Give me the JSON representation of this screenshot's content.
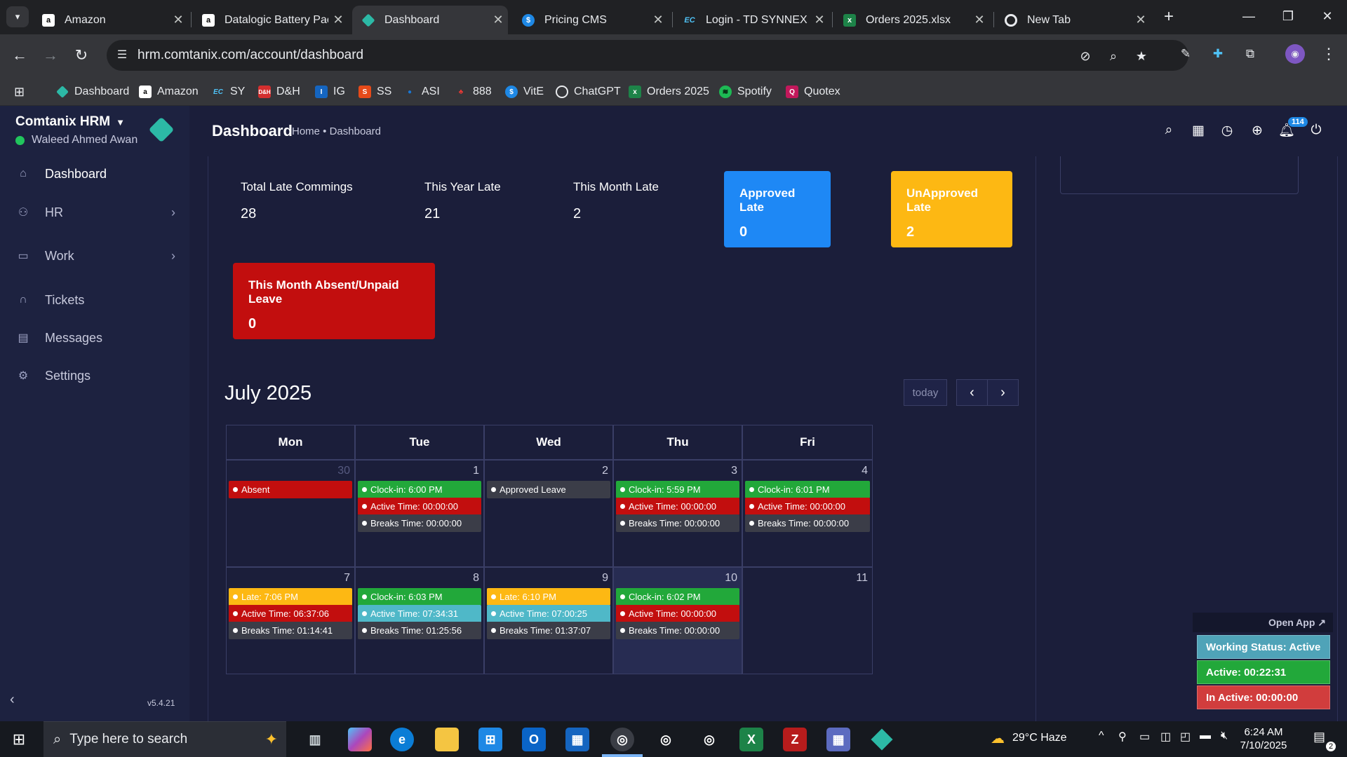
{
  "browser": {
    "tabs": [
      {
        "title": "Amazon",
        "icon": "amazon-icon",
        "active": false
      },
      {
        "title": "Datalogic Battery Pac",
        "icon": "amazon-icon",
        "active": false
      },
      {
        "title": "Dashboard",
        "icon": "comtanix-icon",
        "active": true
      },
      {
        "title": "Pricing CMS",
        "icon": "dollar-icon",
        "active": false
      },
      {
        "title": "Login - TD SYNNEX",
        "icon": "ec-icon",
        "active": false
      },
      {
        "title": "Orders 2025.xlsx",
        "icon": "excel-icon",
        "active": false
      },
      {
        "title": "New Tab",
        "icon": "chrome-icon",
        "active": false
      }
    ],
    "url": "hrm.comtanix.com/account/dashboard",
    "bookmarks": [
      {
        "label": "Dashboard",
        "icon": "comtanix-icon",
        "color": "#2cb9a6"
      },
      {
        "label": "Amazon",
        "icon": "amazon-icon",
        "color": "#ffffff"
      },
      {
        "label": "SY",
        "icon": "ec-icon",
        "color": "#1e88e5"
      },
      {
        "label": "D&H",
        "icon": "dh-icon",
        "color": "#d32f2f"
      },
      {
        "label": "IG",
        "icon": "ig-icon",
        "color": "#1565c0"
      },
      {
        "label": "SS",
        "icon": "ss-icon",
        "color": "#e64a19"
      },
      {
        "label": "ASI",
        "icon": "asi-icon",
        "color": "#1976d2"
      },
      {
        "label": "888",
        "icon": "888-icon",
        "color": "#e53935"
      },
      {
        "label": "VitE",
        "icon": "dollar-icon",
        "color": "#1e88e5"
      },
      {
        "label": "ChatGPT",
        "icon": "chatgpt-icon",
        "color": "#e8eaed"
      },
      {
        "label": "Orders 2025",
        "icon": "excel-icon",
        "color": "#1d8348"
      },
      {
        "label": "Spotify",
        "icon": "spotify-icon",
        "color": "#1db954"
      },
      {
        "label": "Quotex",
        "icon": "quotex-icon",
        "color": "#c2185b"
      }
    ]
  },
  "sidebar": {
    "company": "Comtanix HRM",
    "user": "Waleed Ahmed Awan",
    "items": [
      {
        "label": "Dashboard",
        "icon": "home-icon",
        "has_children": false,
        "active": true
      },
      {
        "label": "HR",
        "icon": "users-icon",
        "has_children": true,
        "active": false
      },
      {
        "label": "Work",
        "icon": "briefcase-icon",
        "has_children": true,
        "active": false
      },
      {
        "label": "Tickets",
        "icon": "headset-icon",
        "has_children": false,
        "active": false
      },
      {
        "label": "Messages",
        "icon": "message-icon",
        "has_children": false,
        "active": false
      },
      {
        "label": "Settings",
        "icon": "gear-icon",
        "has_children": false,
        "active": false
      }
    ],
    "version": "v5.4.21"
  },
  "header": {
    "title": "Dashboard",
    "breadcrumb": "Home • Dashboard",
    "notification_count": "114"
  },
  "stats": [
    {
      "label": "Total Late Commings",
      "value": "28"
    },
    {
      "label": "This Year Late",
      "value": "21"
    },
    {
      "label": "This Month Late",
      "value": "2"
    }
  ],
  "cards": {
    "approved": {
      "label": "Approved Late",
      "value": "0",
      "color": "#1e88f5"
    },
    "unapproved": {
      "label": "UnApproved Late",
      "value": "2",
      "color": "#fdb813"
    },
    "absent": {
      "label": "This Month Absent/Unpaid Leave",
      "value": "0",
      "color": "#c20e0e"
    }
  },
  "calendar": {
    "title": "July 2025",
    "today_label": "today",
    "weekdays": [
      "Mon",
      "Tue",
      "Wed",
      "Thu",
      "Fri"
    ],
    "weeks": [
      [
        {
          "day": "30",
          "other": true,
          "events": [
            {
              "text": "Absent",
              "kind": "red"
            }
          ]
        },
        {
          "day": "1",
          "events": [
            {
              "text": "Clock-in: 6:00 PM",
              "kind": "green"
            },
            {
              "text": "Active Time: 00:00:00",
              "kind": "red"
            },
            {
              "text": "Breaks Time: 00:00:00",
              "kind": "gray"
            }
          ]
        },
        {
          "day": "2",
          "events": [
            {
              "text": "Approved Leave",
              "kind": "gray"
            }
          ]
        },
        {
          "day": "3",
          "events": [
            {
              "text": "Clock-in: 5:59 PM",
              "kind": "green"
            },
            {
              "text": "Active Time: 00:00:00",
              "kind": "red"
            },
            {
              "text": "Breaks Time: 00:00:00",
              "kind": "gray"
            }
          ]
        },
        {
          "day": "4",
          "events": [
            {
              "text": "Clock-in: 6:01 PM",
              "kind": "green"
            },
            {
              "text": "Active Time: 00:00:00",
              "kind": "red"
            },
            {
              "text": "Breaks Time: 00:00:00",
              "kind": "gray"
            }
          ]
        }
      ],
      [
        {
          "day": "7",
          "events": [
            {
              "text": "Late: 7:06 PM",
              "kind": "yellow"
            },
            {
              "text": "Active Time: 06:37:06",
              "kind": "red"
            },
            {
              "text": "Breaks Time: 01:14:41",
              "kind": "gray"
            }
          ]
        },
        {
          "day": "8",
          "events": [
            {
              "text": "Clock-in: 6:03 PM",
              "kind": "green"
            },
            {
              "text": "Active Time: 07:34:31",
              "kind": "teal"
            },
            {
              "text": "Breaks Time: 01:25:56",
              "kind": "gray"
            }
          ]
        },
        {
          "day": "9",
          "events": [
            {
              "text": "Late: 6:10 PM",
              "kind": "yellow"
            },
            {
              "text": "Active Time: 07:00:25",
              "kind": "teal"
            },
            {
              "text": "Breaks Time: 01:37:07",
              "kind": "gray"
            }
          ]
        },
        {
          "day": "10",
          "today": true,
          "events": [
            {
              "text": "Clock-in: 6:02 PM",
              "kind": "green"
            },
            {
              "text": "Active Time: 00:00:00",
              "kind": "red"
            },
            {
              "text": "Breaks Time: 00:00:00",
              "kind": "gray"
            }
          ]
        },
        {
          "day": "11",
          "events": []
        }
      ]
    ],
    "event_colors": {
      "green": "#22a83a",
      "red": "#c20e0e",
      "gray": "#3b3d48",
      "yellow": "#fdb813",
      "teal": "#4fb8c8"
    }
  },
  "widget": {
    "open_app": "Open App ↗",
    "working_status": "Working Status: Active",
    "active": "Active: 00:22:31",
    "inactive": "In Active: 00:00:00",
    "colors": {
      "status": "#4fa3b8",
      "active": "#22a83a",
      "inactive": "#d13d3d"
    }
  },
  "taskbar": {
    "search_placeholder": "Type here to search",
    "weather": "29°C  Haze",
    "time": "6:24 AM",
    "date": "7/10/2025",
    "notification_count": "2"
  }
}
